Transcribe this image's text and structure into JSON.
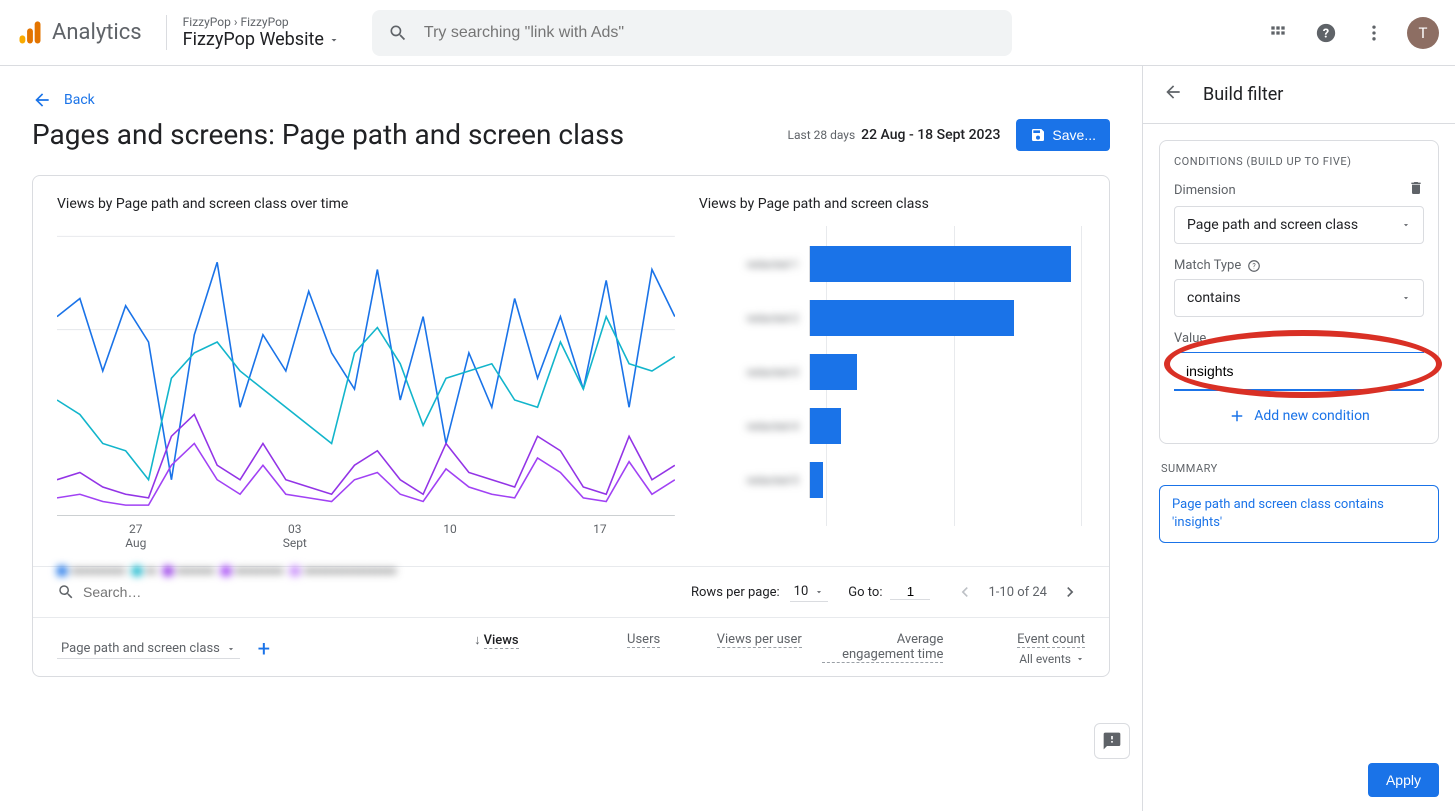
{
  "header": {
    "app_name": "Analytics",
    "breadcrumb_parent": "FizzyPop",
    "breadcrumb_child": "FizzyPop",
    "property": "FizzyPop Website",
    "search_placeholder": "Try searching \"link with Ads\"",
    "avatar_initial": "T"
  },
  "back_label": "Back",
  "page_title": "Pages and screens: Page path and screen class",
  "date_range": {
    "label": "Last 28 days",
    "value": "22 Aug - 18 Sept 2023"
  },
  "save_label": "Save...",
  "charts": {
    "line_title": "Views by Page path and screen class over time",
    "bar_title": "Views by Page path and screen class",
    "x_ticks": [
      {
        "d": "27",
        "m": "Aug"
      },
      {
        "d": "03",
        "m": "Sept"
      },
      {
        "d": "10",
        "m": ""
      },
      {
        "d": "17",
        "m": ""
      }
    ]
  },
  "chart_data": {
    "type": "bar",
    "categories": [
      "redacted-1",
      "redacted-2",
      "redacted-3",
      "redacted-4",
      "redacted-5"
    ],
    "values": [
      100,
      78,
      18,
      12,
      5
    ],
    "title": "Views by Page path and screen class"
  },
  "chart_data_line": {
    "type": "line",
    "x": [
      1,
      2,
      3,
      4,
      5,
      6,
      7,
      8,
      9,
      10,
      11,
      12,
      13,
      14,
      15,
      16,
      17,
      18,
      19,
      20,
      21,
      22,
      23,
      24,
      25,
      26,
      27,
      28
    ],
    "series": [
      {
        "name": "s1",
        "color": "#1a73e8",
        "values": [
          55,
          60,
          40,
          58,
          48,
          10,
          50,
          70,
          30,
          50,
          40,
          62,
          45,
          35,
          68,
          32,
          55,
          20,
          45,
          30,
          60,
          38,
          55,
          35,
          65,
          30,
          68,
          55
        ]
      },
      {
        "name": "s2",
        "color": "#12b5cb",
        "values": [
          32,
          28,
          20,
          18,
          10,
          38,
          45,
          48,
          40,
          35,
          30,
          25,
          20,
          45,
          52,
          42,
          25,
          38,
          40,
          42,
          32,
          30,
          48,
          35,
          55,
          42,
          40,
          44
        ]
      },
      {
        "name": "s3",
        "color": "#9334e6",
        "values": [
          10,
          12,
          8,
          6,
          5,
          22,
          28,
          14,
          10,
          20,
          10,
          8,
          6,
          14,
          18,
          10,
          6,
          20,
          12,
          10,
          8,
          22,
          18,
          8,
          6,
          22,
          10,
          14
        ]
      },
      {
        "name": "s4",
        "color": "#a142f4",
        "values": [
          5,
          6,
          4,
          3,
          3,
          14,
          20,
          10,
          6,
          14,
          6,
          5,
          4,
          10,
          12,
          6,
          4,
          13,
          8,
          6,
          5,
          16,
          12,
          5,
          4,
          15,
          6,
          10
        ]
      }
    ],
    "x_tick_labels": [
      "27 Aug",
      "03 Sept",
      "10",
      "17"
    ]
  },
  "table_controls": {
    "search_placeholder": "Search…",
    "rows_label": "Rows per page:",
    "rows_value": "10",
    "goto_label": "Go to:",
    "goto_value": "1",
    "pager_text": "1-10 of 24"
  },
  "table_head": {
    "dim": "Page path and screen class",
    "cols": {
      "views": "Views",
      "users": "Users",
      "views_per_user": "Views per user",
      "avg_eng": "Average engagement time",
      "event_count": "Event count",
      "event_sub": "All events"
    }
  },
  "filter": {
    "title": "Build filter",
    "cond_title": "Conditions (build up to five)",
    "dim_label": "Dimension",
    "dim_value": "Page path and screen class",
    "match_label": "Match Type",
    "match_value": "contains",
    "value_label": "Value",
    "value_input": "insights",
    "add_cond": "Add new condition",
    "summary_label": "Summary",
    "summary_text": "Page path and screen class contains 'insights'",
    "apply_label": "Apply"
  }
}
